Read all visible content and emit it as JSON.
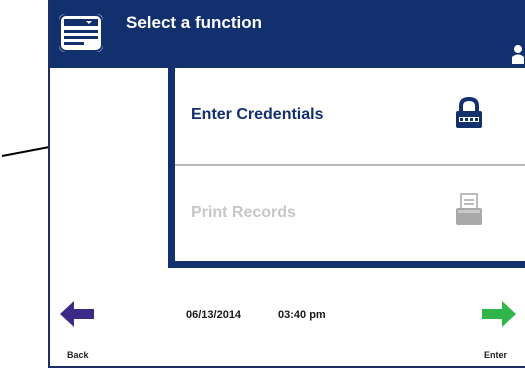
{
  "header": {
    "title": "Select a function",
    "icon": "menu-card-icon",
    "user_icon": "user-icon"
  },
  "menu": {
    "items": [
      {
        "label": "Enter Credentials",
        "icon": "lock-icon",
        "enabled": true
      },
      {
        "label": "Print Records",
        "icon": "printer-icon",
        "enabled": false
      }
    ]
  },
  "footer": {
    "date": "06/13/2014",
    "time": "03:40 pm",
    "back_label": "Back",
    "enter_label": "Enter"
  },
  "colors": {
    "header_bg": "#13306e",
    "back_arrow": "#3b2a86",
    "enter_arrow": "#2fb54a",
    "disabled_text": "#c7c7c7"
  }
}
